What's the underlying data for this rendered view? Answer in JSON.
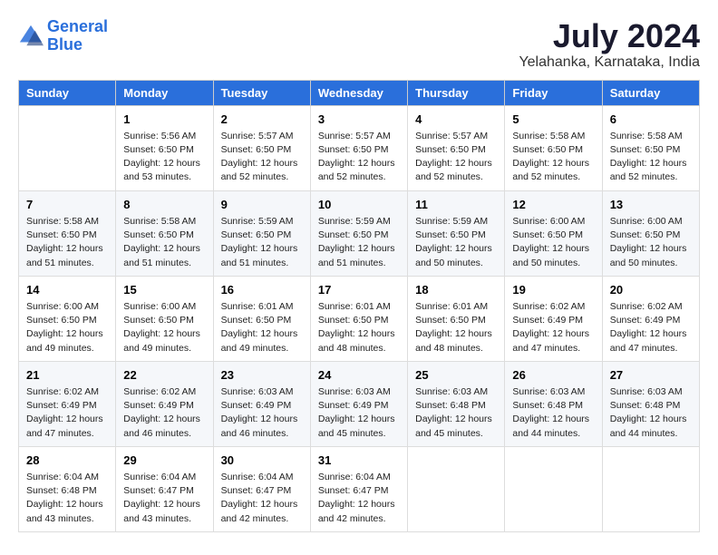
{
  "header": {
    "logo_line1": "General",
    "logo_line2": "Blue",
    "month_year": "July 2024",
    "location": "Yelahanka, Karnataka, India"
  },
  "days_of_week": [
    "Sunday",
    "Monday",
    "Tuesday",
    "Wednesday",
    "Thursday",
    "Friday",
    "Saturday"
  ],
  "weeks": [
    [
      {
        "day": "",
        "info": ""
      },
      {
        "day": "1",
        "info": "Sunrise: 5:56 AM\nSunset: 6:50 PM\nDaylight: 12 hours\nand 53 minutes."
      },
      {
        "day": "2",
        "info": "Sunrise: 5:57 AM\nSunset: 6:50 PM\nDaylight: 12 hours\nand 52 minutes."
      },
      {
        "day": "3",
        "info": "Sunrise: 5:57 AM\nSunset: 6:50 PM\nDaylight: 12 hours\nand 52 minutes."
      },
      {
        "day": "4",
        "info": "Sunrise: 5:57 AM\nSunset: 6:50 PM\nDaylight: 12 hours\nand 52 minutes."
      },
      {
        "day": "5",
        "info": "Sunrise: 5:58 AM\nSunset: 6:50 PM\nDaylight: 12 hours\nand 52 minutes."
      },
      {
        "day": "6",
        "info": "Sunrise: 5:58 AM\nSunset: 6:50 PM\nDaylight: 12 hours\nand 52 minutes."
      }
    ],
    [
      {
        "day": "7",
        "info": "Sunrise: 5:58 AM\nSunset: 6:50 PM\nDaylight: 12 hours\nand 51 minutes."
      },
      {
        "day": "8",
        "info": "Sunrise: 5:58 AM\nSunset: 6:50 PM\nDaylight: 12 hours\nand 51 minutes."
      },
      {
        "day": "9",
        "info": "Sunrise: 5:59 AM\nSunset: 6:50 PM\nDaylight: 12 hours\nand 51 minutes."
      },
      {
        "day": "10",
        "info": "Sunrise: 5:59 AM\nSunset: 6:50 PM\nDaylight: 12 hours\nand 51 minutes."
      },
      {
        "day": "11",
        "info": "Sunrise: 5:59 AM\nSunset: 6:50 PM\nDaylight: 12 hours\nand 50 minutes."
      },
      {
        "day": "12",
        "info": "Sunrise: 6:00 AM\nSunset: 6:50 PM\nDaylight: 12 hours\nand 50 minutes."
      },
      {
        "day": "13",
        "info": "Sunrise: 6:00 AM\nSunset: 6:50 PM\nDaylight: 12 hours\nand 50 minutes."
      }
    ],
    [
      {
        "day": "14",
        "info": "Sunrise: 6:00 AM\nSunset: 6:50 PM\nDaylight: 12 hours\nand 49 minutes."
      },
      {
        "day": "15",
        "info": "Sunrise: 6:00 AM\nSunset: 6:50 PM\nDaylight: 12 hours\nand 49 minutes."
      },
      {
        "day": "16",
        "info": "Sunrise: 6:01 AM\nSunset: 6:50 PM\nDaylight: 12 hours\nand 49 minutes."
      },
      {
        "day": "17",
        "info": "Sunrise: 6:01 AM\nSunset: 6:50 PM\nDaylight: 12 hours\nand 48 minutes."
      },
      {
        "day": "18",
        "info": "Sunrise: 6:01 AM\nSunset: 6:50 PM\nDaylight: 12 hours\nand 48 minutes."
      },
      {
        "day": "19",
        "info": "Sunrise: 6:02 AM\nSunset: 6:49 PM\nDaylight: 12 hours\nand 47 minutes."
      },
      {
        "day": "20",
        "info": "Sunrise: 6:02 AM\nSunset: 6:49 PM\nDaylight: 12 hours\nand 47 minutes."
      }
    ],
    [
      {
        "day": "21",
        "info": "Sunrise: 6:02 AM\nSunset: 6:49 PM\nDaylight: 12 hours\nand 47 minutes."
      },
      {
        "day": "22",
        "info": "Sunrise: 6:02 AM\nSunset: 6:49 PM\nDaylight: 12 hours\nand 46 minutes."
      },
      {
        "day": "23",
        "info": "Sunrise: 6:03 AM\nSunset: 6:49 PM\nDaylight: 12 hours\nand 46 minutes."
      },
      {
        "day": "24",
        "info": "Sunrise: 6:03 AM\nSunset: 6:49 PM\nDaylight: 12 hours\nand 45 minutes."
      },
      {
        "day": "25",
        "info": "Sunrise: 6:03 AM\nSunset: 6:48 PM\nDaylight: 12 hours\nand 45 minutes."
      },
      {
        "day": "26",
        "info": "Sunrise: 6:03 AM\nSunset: 6:48 PM\nDaylight: 12 hours\nand 44 minutes."
      },
      {
        "day": "27",
        "info": "Sunrise: 6:03 AM\nSunset: 6:48 PM\nDaylight: 12 hours\nand 44 minutes."
      }
    ],
    [
      {
        "day": "28",
        "info": "Sunrise: 6:04 AM\nSunset: 6:48 PM\nDaylight: 12 hours\nand 43 minutes."
      },
      {
        "day": "29",
        "info": "Sunrise: 6:04 AM\nSunset: 6:47 PM\nDaylight: 12 hours\nand 43 minutes."
      },
      {
        "day": "30",
        "info": "Sunrise: 6:04 AM\nSunset: 6:47 PM\nDaylight: 12 hours\nand 42 minutes."
      },
      {
        "day": "31",
        "info": "Sunrise: 6:04 AM\nSunset: 6:47 PM\nDaylight: 12 hours\nand 42 minutes."
      },
      {
        "day": "",
        "info": ""
      },
      {
        "day": "",
        "info": ""
      },
      {
        "day": "",
        "info": ""
      }
    ]
  ]
}
